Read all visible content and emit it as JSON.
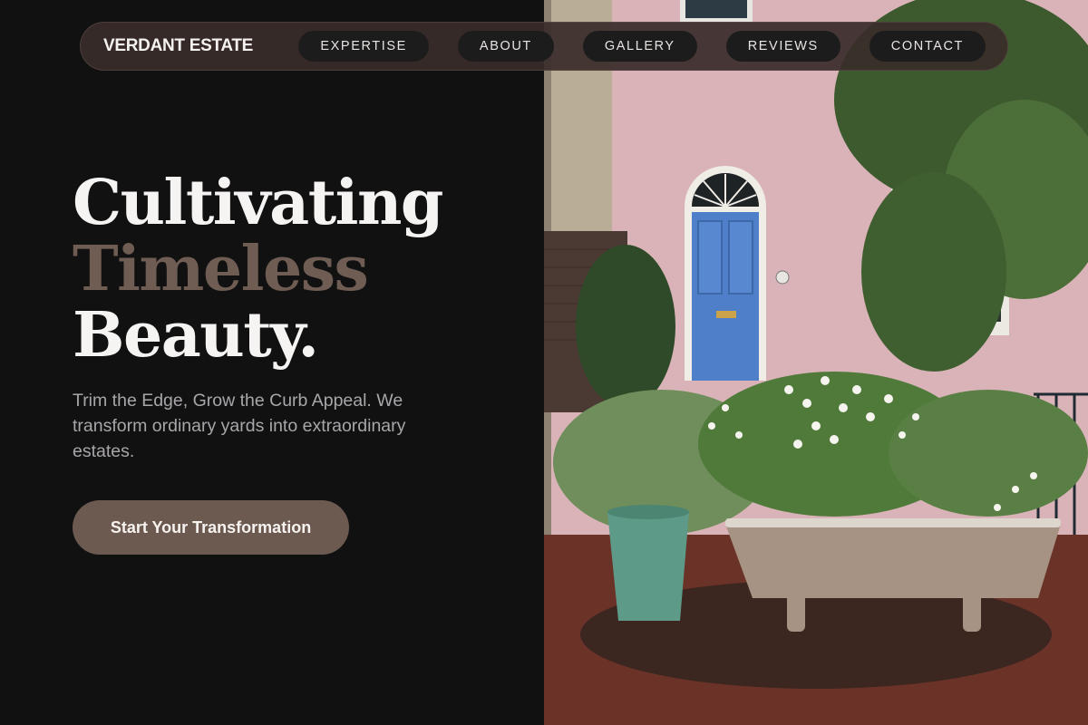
{
  "brand": {
    "name": "VERDANT ESTATE"
  },
  "nav": {
    "items": [
      {
        "label": "EXPERTISE"
      },
      {
        "label": "ABOUT"
      },
      {
        "label": "GALLERY"
      },
      {
        "label": "REVIEWS"
      },
      {
        "label": "CONTACT"
      }
    ]
  },
  "hero": {
    "heading": {
      "line1": "Cultivating",
      "line2": "Timeless",
      "line3": "Beauty."
    },
    "subtitle": "Trim the Edge, Grow the Curb Appeal. We transform ordinary yards into extraordinary estates.",
    "cta_label": "Start Your Transformation",
    "photo_description_icon": "garden-photo"
  },
  "colors": {
    "background": "#111112",
    "accent": "#6c5a50",
    "heading_muted": "#6f5d54",
    "nav_bg": "#3a2c2a",
    "door_blue": "#4e7fc8",
    "wall_pink": "#d8b2b6"
  }
}
